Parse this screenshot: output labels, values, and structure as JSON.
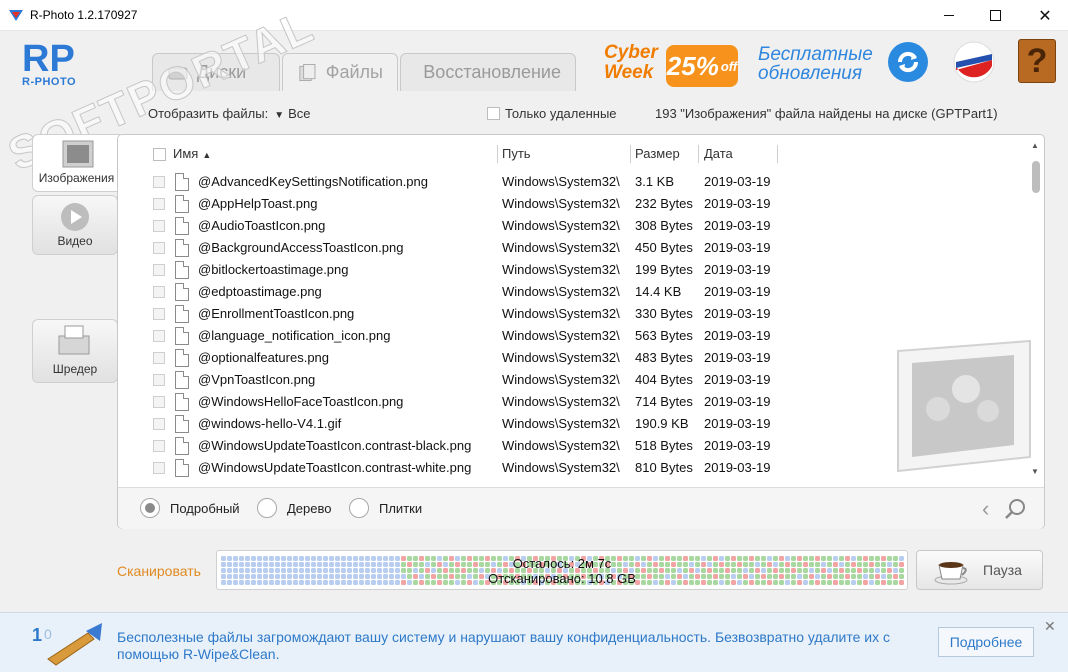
{
  "window": {
    "title": "R-Photo 1.2.170927"
  },
  "header": {
    "logo_text": "R-PHOTO",
    "tabs": [
      {
        "label": "Диски",
        "active": false
      },
      {
        "label": "Файлы",
        "active": true
      },
      {
        "label": "Восстановление",
        "active": false
      }
    ],
    "promo_line1": "Cyber",
    "promo_line2": "Week",
    "promo_percent": "25%",
    "promo_off": "off",
    "free_updates_line1": "Бесплатные",
    "free_updates_line2": "обновления",
    "help_glyph": "?"
  },
  "sidebar": {
    "items": [
      {
        "label": "Изображения",
        "icon": "images-icon",
        "active": true
      },
      {
        "label": "Видео",
        "icon": "video-icon",
        "active": false
      },
      {
        "label": "Шредер",
        "icon": "shredder-icon",
        "active": false
      }
    ]
  },
  "toolbar": {
    "show_files_label": "Отобразить файлы:",
    "show_files_value": "Все",
    "only_deleted_label": "Только удаленные",
    "found_text": "193 \"Изображения\" файла найдены на диске (GPTPart1)"
  },
  "table": {
    "columns": {
      "name": "Имя",
      "path": "Путь",
      "size": "Размер",
      "date": "Дата"
    },
    "rows": [
      {
        "name": "@AdvancedKeySettingsNotification.png",
        "path": "Windows\\System32\\",
        "size": "3.1 KB",
        "date": "2019-03-19"
      },
      {
        "name": "@AppHelpToast.png",
        "path": "Windows\\System32\\",
        "size": "232 Bytes",
        "date": "2019-03-19"
      },
      {
        "name": "@AudioToastIcon.png",
        "path": "Windows\\System32\\",
        "size": "308 Bytes",
        "date": "2019-03-19"
      },
      {
        "name": "@BackgroundAccessToastIcon.png",
        "path": "Windows\\System32\\",
        "size": "450 Bytes",
        "date": "2019-03-19"
      },
      {
        "name": "@bitlockertoastimage.png",
        "path": "Windows\\System32\\",
        "size": "199 Bytes",
        "date": "2019-03-19"
      },
      {
        "name": "@edptoastimage.png",
        "path": "Windows\\System32\\",
        "size": "14.4 KB",
        "date": "2019-03-19"
      },
      {
        "name": "@EnrollmentToastIcon.png",
        "path": "Windows\\System32\\",
        "size": "330 Bytes",
        "date": "2019-03-19"
      },
      {
        "name": "@language_notification_icon.png",
        "path": "Windows\\System32\\",
        "size": "563 Bytes",
        "date": "2019-03-19"
      },
      {
        "name": "@optionalfeatures.png",
        "path": "Windows\\System32\\",
        "size": "483 Bytes",
        "date": "2019-03-19"
      },
      {
        "name": "@VpnToastIcon.png",
        "path": "Windows\\System32\\",
        "size": "404 Bytes",
        "date": "2019-03-19"
      },
      {
        "name": "@WindowsHelloFaceToastIcon.png",
        "path": "Windows\\System32\\",
        "size": "714 Bytes",
        "date": "2019-03-19"
      },
      {
        "name": "@windows-hello-V4.1.gif",
        "path": "Windows\\System32\\",
        "size": "190.9 KB",
        "date": "2019-03-19"
      },
      {
        "name": "@WindowsUpdateToastIcon.contrast-black.png",
        "path": "Windows\\System32\\",
        "size": "518 Bytes",
        "date": "2019-03-19"
      },
      {
        "name": "@WindowsUpdateToastIcon.contrast-white.png",
        "path": "Windows\\System32\\",
        "size": "810 Bytes",
        "date": "2019-03-19"
      }
    ]
  },
  "view_modes": [
    {
      "label": "Подробный",
      "selected": true
    },
    {
      "label": "Дерево",
      "selected": false
    },
    {
      "label": "Плитки",
      "selected": false
    }
  ],
  "scan": {
    "label": "Сканировать",
    "remaining": "Осталось: 2м 7с",
    "scanned": "Отсканировано: 10.8 GB",
    "pause_label": "Пауза"
  },
  "ad": {
    "text": "Бесполезные файлы загромождают вашу систему и нарушают вашу конфиденциальность. Безвозвратно удалите их с помощью R-Wipe&Clean.",
    "more_label": "Подробнее",
    "close_glyph": "✕"
  },
  "watermark": {
    "text": "SOFTPORTAL",
    "url": "www.softportal.com"
  },
  "colors": {
    "accent_blue": "#2e79c9",
    "accent_orange": "#f7931d",
    "scan_blue": "#b9cdf0",
    "scan_green": "#a8d8a0",
    "scan_red": "#f2a3a3"
  }
}
